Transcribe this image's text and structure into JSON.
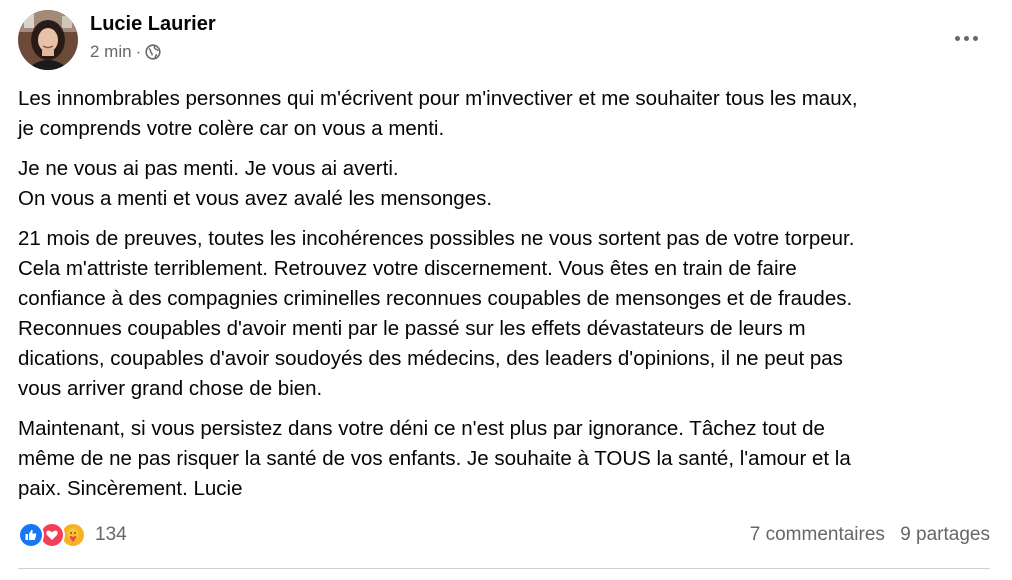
{
  "author": {
    "name": "Lucie Laurier",
    "time": "2 min",
    "separator": "·",
    "audience_icon": "globe-icon"
  },
  "post": {
    "paragraphs": [
      "Les innombrables personnes qui m'écrivent pour m'invectiver et me souhaiter tous les maux,\nje comprends votre colère car on vous a menti.",
      "Je ne vous ai pas menti. Je vous ai averti.\nOn vous a menti et vous avez avalé les mensonges.",
      "21 mois de preuves, toutes les incohérences possibles ne vous sortent pas de votre torpeur.\nCela m'attriste terriblement. Retrouvez votre discernement. Vous êtes en train de faire\nconfiance à des compagnies criminelles reconnues coupables de mensonges et de fraudes.\nReconnues coupables d'avoir menti par le passé sur les effets dévastateurs de leurs m\ndications, coupables d'avoir soudoyés des médecins, des leaders d'opinions, il ne peut pas\nvous arriver grand chose de bien.",
      "Maintenant, si vous persistez dans votre déni ce n'est plus par ignorance. Tâchez tout de\nmême de ne pas risquer la santé de vos enfants. Je souhaite à TOUS la santé, l'amour et la\npaix. Sincèrement. Lucie"
    ]
  },
  "reactions": {
    "icons": [
      "like-icon",
      "love-icon",
      "care-icon"
    ],
    "count": "134"
  },
  "stats": {
    "comments": "7 commentaires",
    "shares": "9 partages"
  },
  "colors": {
    "like": "#1877f2",
    "love": "#f33e58",
    "care": "#f7b125",
    "secondary_text": "#65676b",
    "divider": "#ced0d4"
  }
}
